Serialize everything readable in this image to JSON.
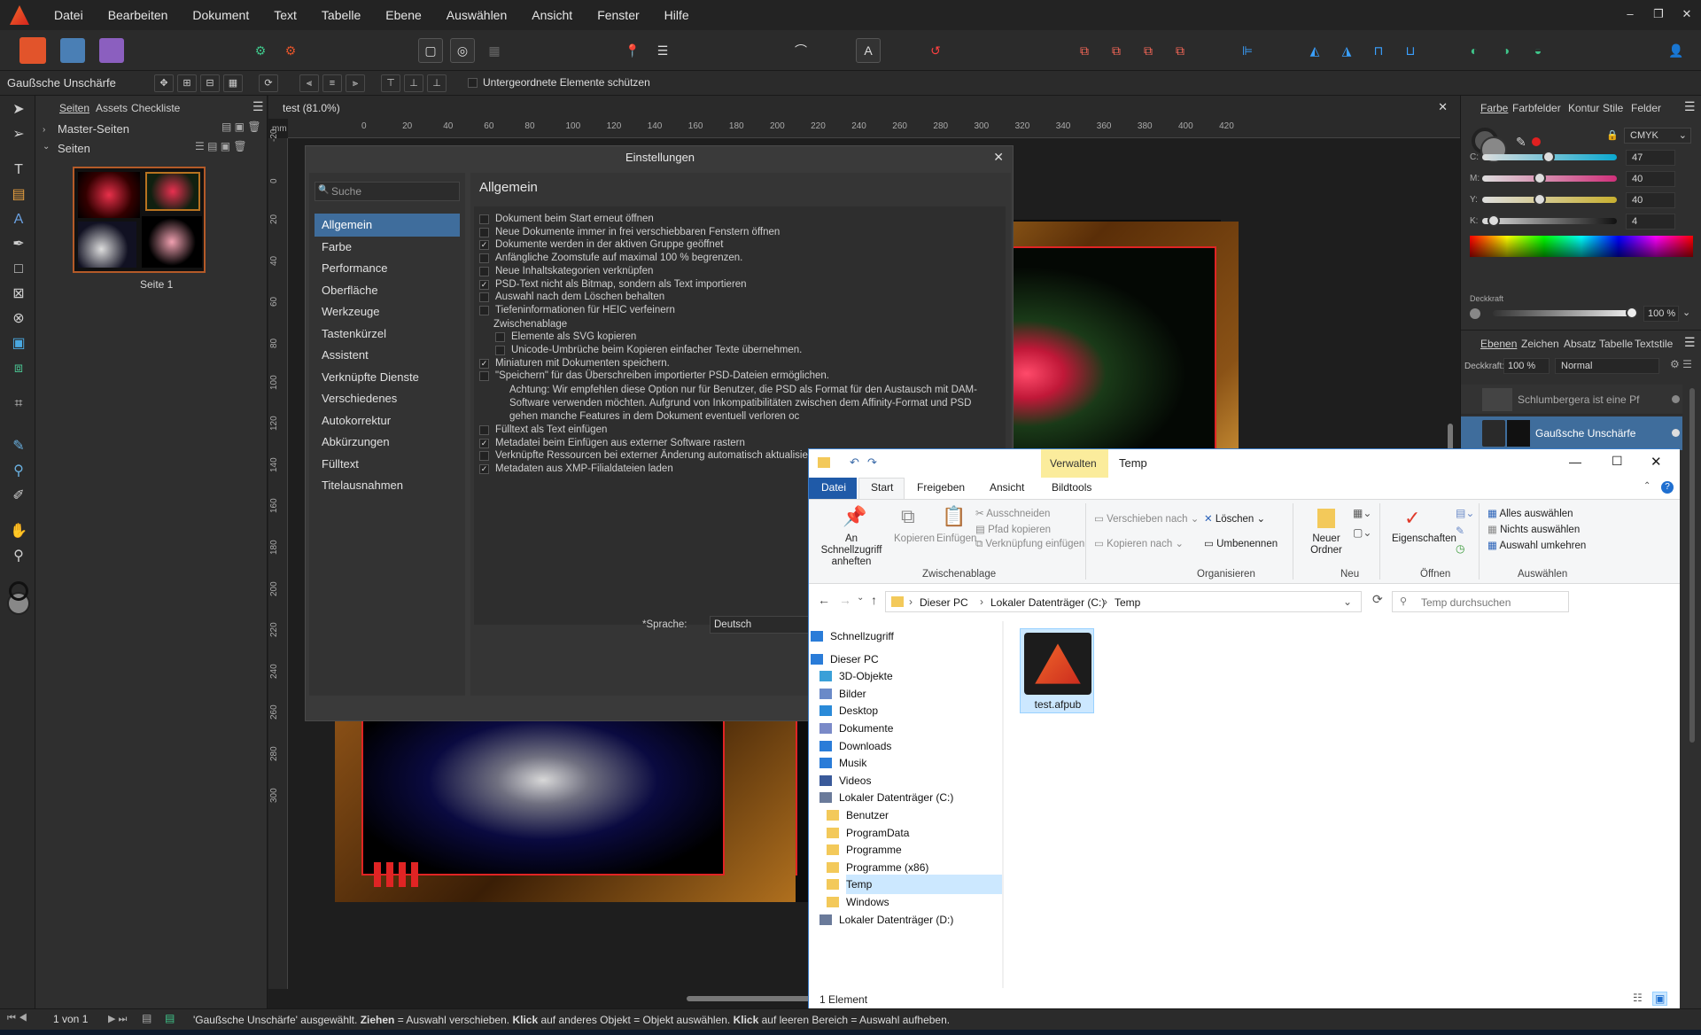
{
  "menu": [
    "Datei",
    "Bearbeiten",
    "Dokument",
    "Text",
    "Tabelle",
    "Ebene",
    "Auswählen",
    "Ansicht",
    "Fenster",
    "Hilfe"
  ],
  "window_controls": {
    "minimize": "–",
    "restore": "❐",
    "close": "✕"
  },
  "context": {
    "tool_name": "Gaußsche Unschärfe",
    "protect_label": "Untergeordnete Elemente schützen"
  },
  "pages_panel": {
    "tabs": [
      "Seiten",
      "Assets",
      "Checkliste"
    ],
    "master_label": "Master-Seiten",
    "pages_label": "Seiten",
    "page1_label": "Seite 1"
  },
  "document": {
    "tab_title": "test (81.0%)",
    "h_ticks": [
      "0",
      "20",
      "40",
      "60",
      "80",
      "100",
      "120",
      "140",
      "160",
      "180",
      "200",
      "220",
      "240",
      "260",
      "280",
      "300",
      "320",
      "340",
      "360",
      "380",
      "400",
      "420"
    ],
    "v_ticks": [
      "-20",
      "0",
      "20",
      "40",
      "60",
      "80",
      "100",
      "120",
      "140",
      "160",
      "180",
      "200",
      "220",
      "240",
      "260",
      "280",
      "300"
    ],
    "unit": "mm"
  },
  "settings": {
    "title": "Einstellungen",
    "search_placeholder": "Suche",
    "nav": [
      "Allgemein",
      "Farbe",
      "Performance",
      "Oberfläche",
      "Werkzeuge",
      "Tastenkürzel",
      "Assistent",
      "Verknüpfte Dienste",
      "Verschiedenes",
      "Autokorrektur",
      "Abkürzungen",
      "Fülltext",
      "Titelausnahmen"
    ],
    "section_title": "Allgemein",
    "options": [
      {
        "label": "Dokument beim Start erneut öffnen",
        "checked": false
      },
      {
        "label": "Neue Dokumente immer in frei verschiebbaren Fenstern öffnen",
        "checked": false
      },
      {
        "label": "Dokumente werden in der aktiven Gruppe geöffnet",
        "checked": true
      },
      {
        "label": "Anfängliche Zoomstufe auf maximal 100 % begrenzen.",
        "checked": false
      },
      {
        "label": "Neue Inhaltskategorien verknüpfen",
        "checked": false
      },
      {
        "label": "PSD-Text nicht als Bitmap, sondern als Text importieren",
        "checked": true
      },
      {
        "label": "Auswahl nach dem Löschen behalten",
        "checked": false
      },
      {
        "label": "Tiefeninformationen für HEIC verfeinern",
        "checked": false
      }
    ],
    "clipboard_heading": "Zwischenablage",
    "clipboard_options": [
      {
        "label": "Elemente als SVG kopieren",
        "checked": false
      },
      {
        "label": "Unicode-Umbrüche beim Kopieren einfacher Texte übernehmen.",
        "checked": false
      }
    ],
    "options2": [
      {
        "label": "Miniaturen mit Dokumenten speichern.",
        "checked": true
      },
      {
        "label": "\"Speichern\" für das Überschreiben importierter PSD-Dateien ermöglichen.",
        "checked": false
      }
    ],
    "warning_lines": [
      "Achtung: Wir empfehlen diese Option nur für Benutzer, die PSD als Format für den Austausch mit DAM-",
      "Software verwenden möchten. Aufgrund von Inkompatibilitäten zwischen dem Affinity-Format und PSD",
      "gehen manche Features in dem Dokument eventuell verloren oc"
    ],
    "options3": [
      {
        "label": "Fülltext als Text einfügen",
        "checked": false
      },
      {
        "label": "Metadatei beim Einfügen aus externer Software rastern",
        "checked": true
      },
      {
        "label": "Verknüpfte Ressourcen bei externer Änderung automatisch aktualisiere",
        "checked": false
      },
      {
        "label": "Metadaten aus XMP-Filialdateien laden",
        "checked": true
      }
    ],
    "language_label": "*Sprache:",
    "language_value": "Deutsch"
  },
  "right_panel": {
    "tabs1": [
      "Farbe",
      "Farbfelder",
      "Kontur",
      "Stile",
      "Felder"
    ],
    "color_mode": "CMYK",
    "sliders": [
      {
        "label": "C:",
        "value": "47",
        "pos": 0.47
      },
      {
        "label": "M:",
        "value": "40",
        "pos": 0.4
      },
      {
        "label": "Y:",
        "value": "40",
        "pos": 0.4
      },
      {
        "label": "K:",
        "value": "4",
        "pos": 0.04
      }
    ],
    "opacity_label": "Deckkraft",
    "opacity_value": "100 %",
    "tabs2": [
      "Ebenen",
      "Zeichen",
      "Absatz",
      "Tabelle",
      "Textstile"
    ],
    "layer_opacity_label": "Deckkraft:",
    "layer_opacity_value": "100 %",
    "blend_mode": "Normal",
    "layers": [
      "Schlumbergera ist eine Pf",
      "Gaußsche Unschärfe"
    ]
  },
  "explorer": {
    "manage_tab": "Verwalten",
    "title": "Temp",
    "tabs": [
      "Datei",
      "Start",
      "Freigeben",
      "Ansicht",
      "Bildtools"
    ],
    "ribbon": {
      "pin": "An Schnellzugriff anheften",
      "copy": "Kopieren",
      "paste": "Einfügen",
      "cut": "Ausschneiden",
      "copy_path": "Pfad kopieren",
      "paste_link": "Verknüpfung einfügen",
      "move_to": "Verschieben nach",
      "copy_to": "Kopieren nach",
      "delete": "Löschen",
      "rename": "Umbenennen",
      "new_folder": "Neuer Ordner",
      "properties": "Eigenschaften",
      "select_all": "Alles auswählen",
      "select_none": "Nichts auswählen",
      "invert": "Auswahl umkehren",
      "groups": [
        "Zwischenablage",
        "Organisieren",
        "Neu",
        "Öffnen",
        "Auswählen"
      ]
    },
    "breadcrumb": [
      "Dieser PC",
      "Lokaler Datenträger (C:)",
      "Temp"
    ],
    "search_placeholder": "Temp durchsuchen",
    "nav": [
      "Schnellzugriff",
      "Dieser PC",
      "3D-Objekte",
      "Bilder",
      "Desktop",
      "Dokumente",
      "Downloads",
      "Musik",
      "Videos",
      "Lokaler Datenträger (C:)",
      "Benutzer",
      "ProgramData",
      "Programme",
      "Programme (x86)",
      "Temp",
      "Windows",
      "Lokaler Datenträger (D:)"
    ],
    "file_name": "test.afpub",
    "status": "1 Element"
  },
  "status_bar": {
    "page_counter": "1 von 1",
    "hint_parts": [
      "'Gaußsche Unschärfe' ausgewählt. ",
      "Ziehen",
      " = Auswahl verschieben. ",
      "Klick",
      " auf anderes Objekt = Objekt auswählen. ",
      "Klick",
      " auf leeren Bereich = Auswahl aufheben."
    ]
  }
}
